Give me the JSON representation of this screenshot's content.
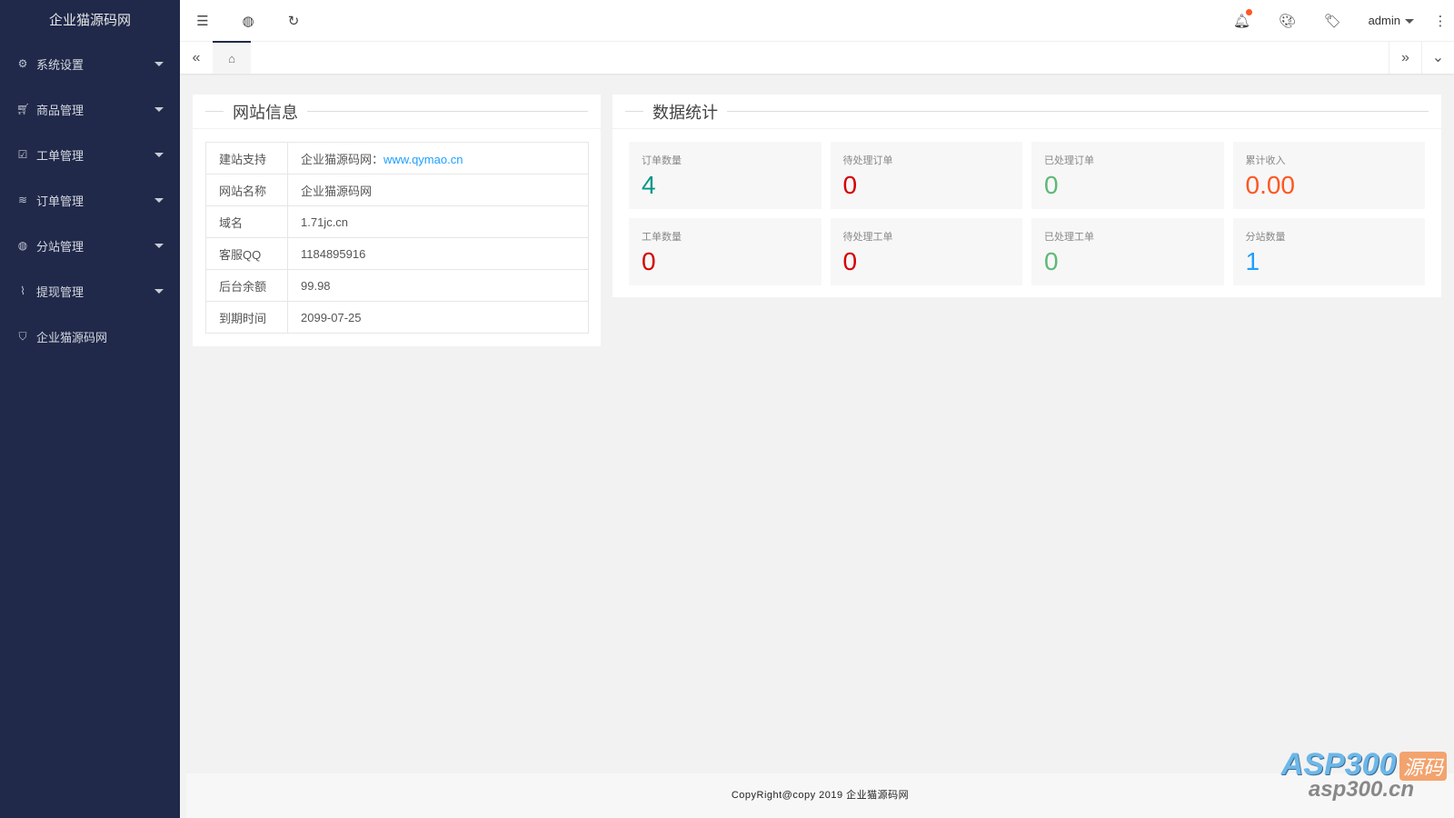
{
  "app": {
    "title": "企业猫源码网"
  },
  "sidebar": {
    "items": [
      {
        "label": "系统设置",
        "icon": "gear-icon"
      },
      {
        "label": "商品管理",
        "icon": "cart-icon"
      },
      {
        "label": "工单管理",
        "icon": "ticket-icon"
      },
      {
        "label": "订单管理",
        "icon": "layers-icon"
      },
      {
        "label": "分站管理",
        "icon": "globe-icon"
      },
      {
        "label": "提现管理",
        "icon": "pulse-icon"
      },
      {
        "label": "企业猫源码网",
        "icon": "shield-icon"
      }
    ]
  },
  "header": {
    "user": "admin"
  },
  "site_info": {
    "title": "网站信息",
    "rows": [
      {
        "key": "建站支持",
        "value": "企业猫源码网：",
        "link": "www.qymao.cn"
      },
      {
        "key": "网站名称",
        "value": "企业猫源码网"
      },
      {
        "key": "域名",
        "value": "1.71jc.cn"
      },
      {
        "key": "客服QQ",
        "value": "1184895916"
      },
      {
        "key": "后台余额",
        "value": "99.98"
      },
      {
        "key": "到期时间",
        "value": "2099-07-25"
      }
    ]
  },
  "stats": {
    "title": "数据统计",
    "items": [
      {
        "label": "订单数量",
        "value": "4",
        "color": "#009688"
      },
      {
        "label": "待处理订单",
        "value": "0",
        "color": "#d40000"
      },
      {
        "label": "已处理订单",
        "value": "0",
        "color": "#5fb878"
      },
      {
        "label": "累计收入",
        "value": "0.00",
        "color": "#ff5722"
      },
      {
        "label": "工单数量",
        "value": "0",
        "color": "#d40000"
      },
      {
        "label": "待处理工单",
        "value": "0",
        "color": "#d40000"
      },
      {
        "label": "已处理工单",
        "value": "0",
        "color": "#5fb878"
      },
      {
        "label": "分站数量",
        "value": "1",
        "color": "#1e9fff"
      }
    ]
  },
  "footer": {
    "text": "CopyRight@copy 2019 企业猫源码网"
  },
  "watermark": {
    "brand": "ASP300",
    "tag": "源码",
    "url": "asp300.cn"
  }
}
